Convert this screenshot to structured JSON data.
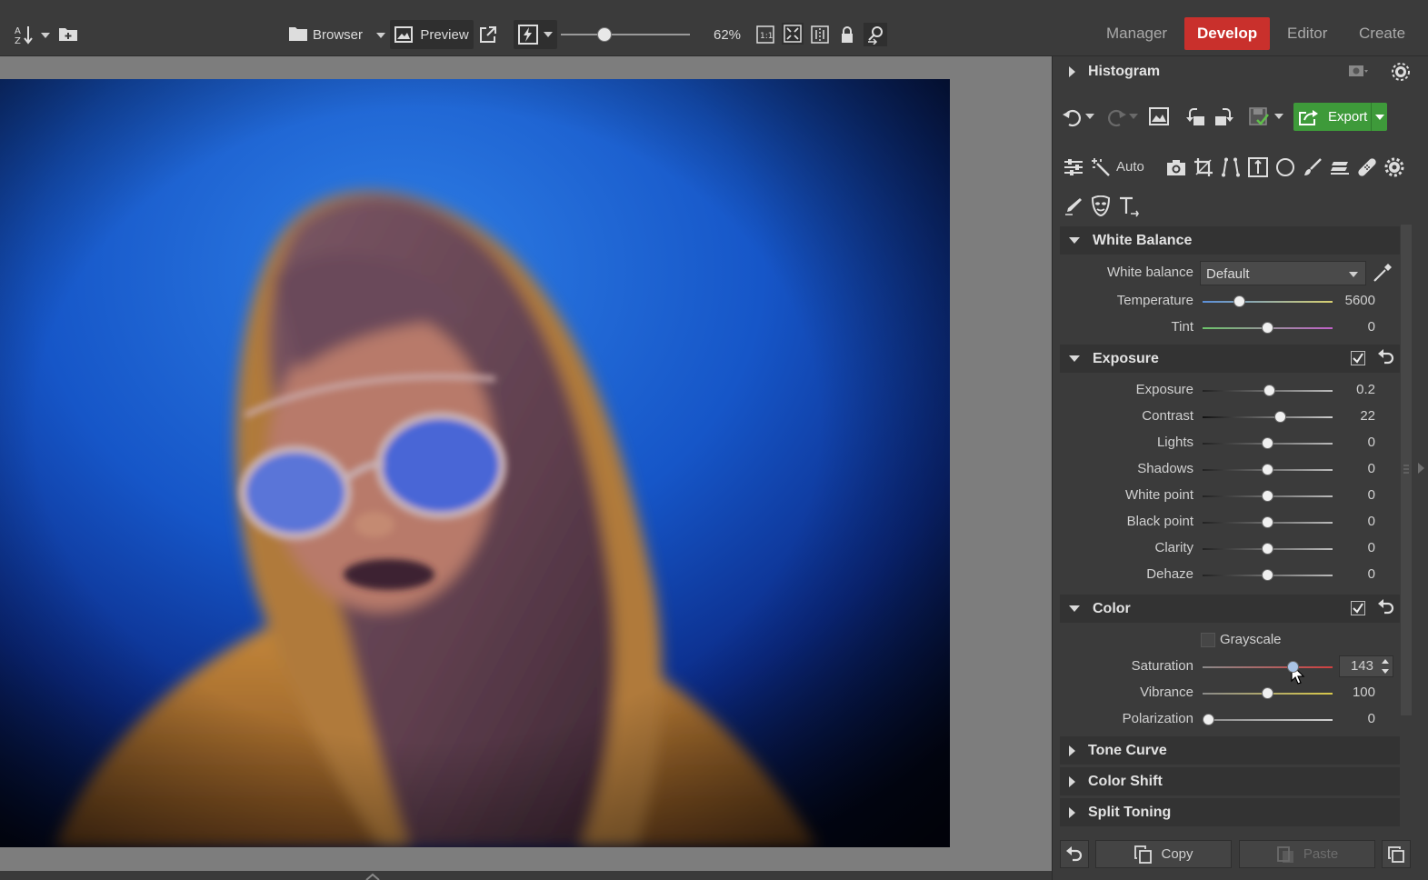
{
  "toolbar": {
    "browser_label": "Browser",
    "preview_label": "Preview",
    "zoom_value": "62%",
    "one_to_one_label": "1:1",
    "zoom_level": 0.32
  },
  "modes": [
    {
      "label": "Manager",
      "active": false
    },
    {
      "label": "Develop",
      "active": true
    },
    {
      "label": "Editor",
      "active": false
    },
    {
      "label": "Create",
      "active": false
    }
  ],
  "panel": {
    "histogram_title": "Histogram",
    "export_label": "Export",
    "auto_label": "Auto",
    "white_balance": {
      "title": "White Balance",
      "wb_label": "White balance",
      "wb_value": "Default",
      "temperature": {
        "label": "Temperature",
        "value": "5600",
        "level": 0.29
      },
      "tint": {
        "label": "Tint",
        "value": "0",
        "level": 0.5
      }
    },
    "exposure": {
      "title": "Exposure",
      "rows": [
        {
          "label": "Exposure",
          "value": "0.2",
          "level": 0.52
        },
        {
          "label": "Contrast",
          "value": "22",
          "level": 0.6
        },
        {
          "label": "Lights",
          "value": "0",
          "level": 0.5
        },
        {
          "label": "Shadows",
          "value": "0",
          "level": 0.5
        },
        {
          "label": "White point",
          "value": "0",
          "level": 0.5
        },
        {
          "label": "Black point",
          "value": "0",
          "level": 0.5
        },
        {
          "label": "Clarity",
          "value": "0",
          "level": 0.5
        },
        {
          "label": "Dehaze",
          "value": "0",
          "level": 0.5
        }
      ]
    },
    "color": {
      "title": "Color",
      "grayscale_label": "Grayscale",
      "rows": [
        {
          "label": "Saturation",
          "value": "143",
          "level": 0.7
        },
        {
          "label": "Vibrance",
          "value": "100",
          "level": 0.5
        },
        {
          "label": "Polarization",
          "value": "0",
          "level": 0.05
        }
      ]
    },
    "collapsed_sections": [
      "Tone Curve",
      "Color Shift",
      "Split Toning"
    ],
    "copy_label": "Copy",
    "paste_label": "Paste"
  },
  "colors": {
    "accent_develop": "#c9302c",
    "export_green": "#3e9a3a"
  }
}
